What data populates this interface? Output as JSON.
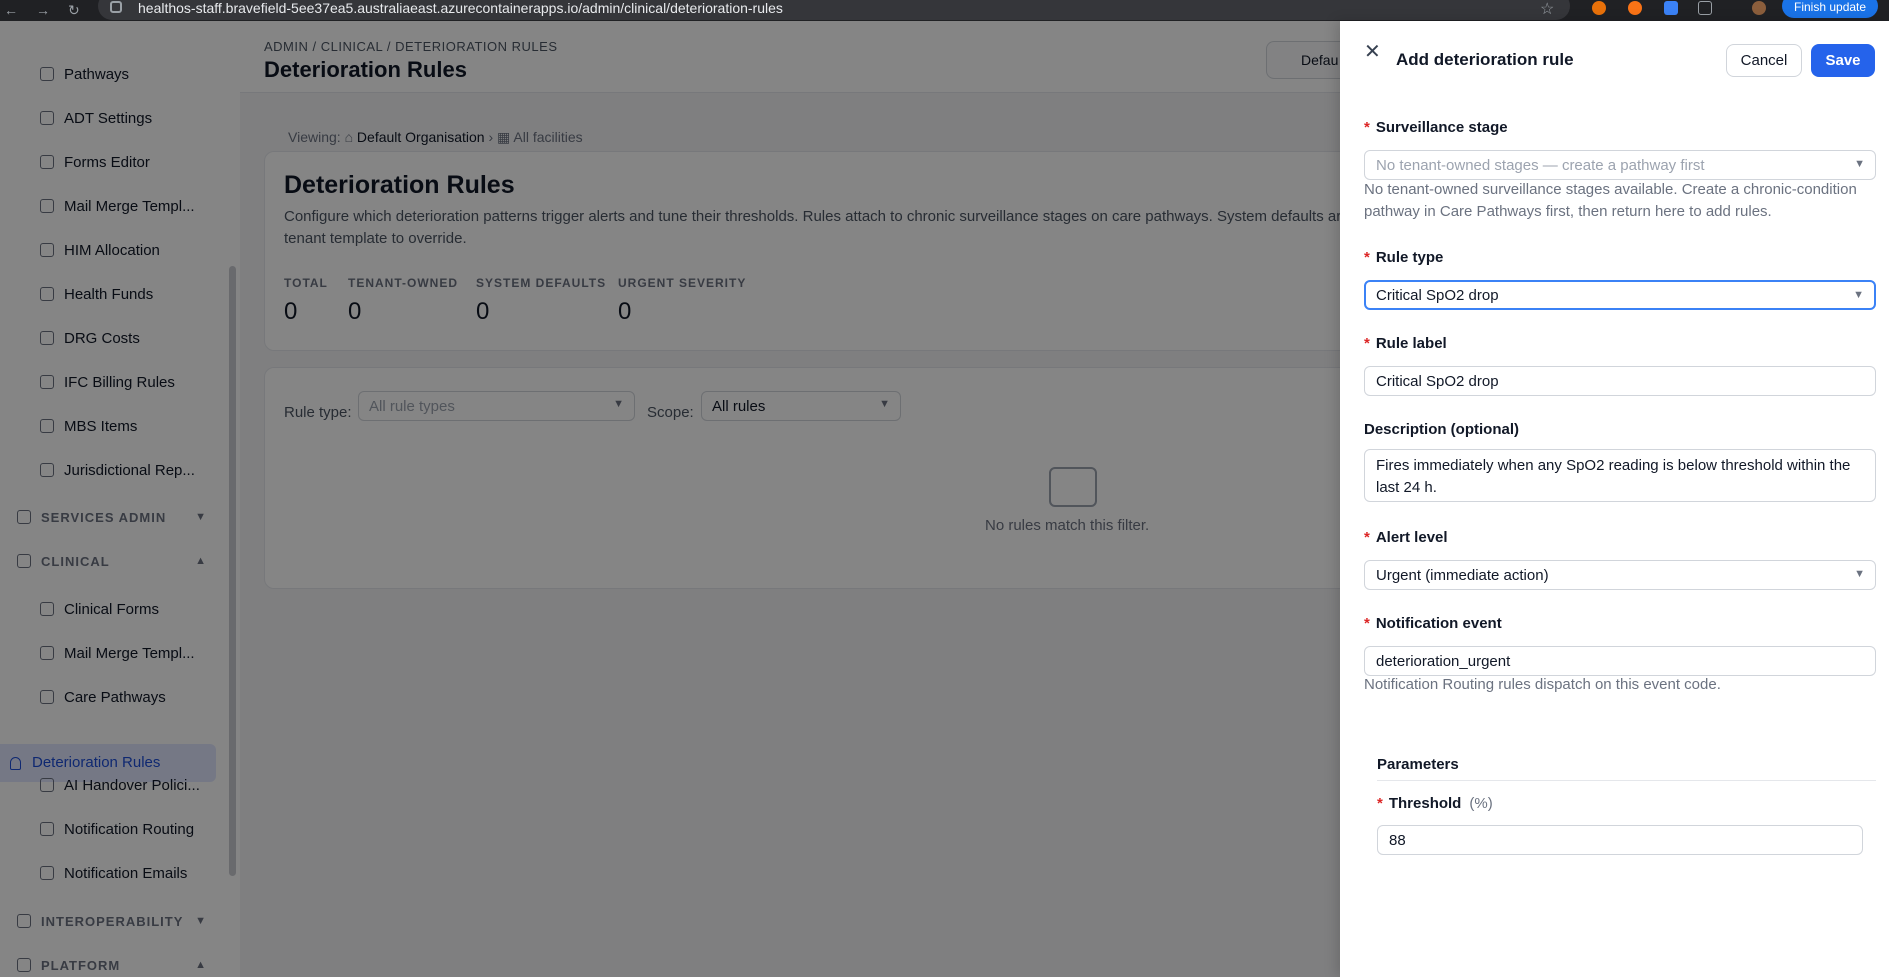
{
  "browser": {
    "url": "healthos-staff.bravefield-5ee37ea5.australiaeast.azurecontainerapps.io/admin/clinical/deterioration-rules",
    "update_label": "Finish update"
  },
  "sidebar": {
    "items_top": [
      {
        "label": "Pathways"
      },
      {
        "label": "ADT Settings"
      },
      {
        "label": "Forms Editor"
      },
      {
        "label": "Mail Merge Templ..."
      },
      {
        "label": "HIM Allocation"
      },
      {
        "label": "Health Funds"
      },
      {
        "label": "DRG Costs"
      },
      {
        "label": "IFC Billing Rules"
      },
      {
        "label": "MBS Items"
      },
      {
        "label": "Jurisdictional Rep..."
      }
    ],
    "sections": {
      "services": "SERVICES ADMIN",
      "clinical": "CLINICAL",
      "interop": "INTEROPERABILITY",
      "platform": "PLATFORM"
    },
    "items_clinical": [
      {
        "label": "Clinical Forms"
      },
      {
        "label": "Mail Merge Templ..."
      },
      {
        "label": "Care Pathways"
      }
    ],
    "active": "Deterioration Rules",
    "items_after": [
      {
        "label": "AI Handover Polici..."
      },
      {
        "label": "Notification Routing"
      },
      {
        "label": "Notification Emails"
      }
    ]
  },
  "header": {
    "breadcrumb": "ADMIN / CLINICAL / DETERIORATION RULES",
    "title": "Deterioration Rules",
    "org_btn": "Defau"
  },
  "viewing": {
    "label": "Viewing:",
    "org": "Default Organisation",
    "facilities": "All facilities"
  },
  "page": {
    "heading": "Deterioration Rules",
    "description": "Configure which deterioration patterns trigger alerts and tune their thresholds. Rules attach to chronic surveillance stages on care pathways. System defaults ar tenant template to override."
  },
  "stats": [
    {
      "key": "TOTAL",
      "value": "0"
    },
    {
      "key": "TENANT-OWNED",
      "value": "0"
    },
    {
      "key": "SYSTEM DEFAULTS",
      "value": "0"
    },
    {
      "key": "URGENT SEVERITY",
      "value": "0"
    }
  ],
  "filters": {
    "rule_type_label": "Rule type:",
    "rule_type_placeholder": "All rule types",
    "scope_label": "Scope:",
    "scope_value": "All rules",
    "empty": "No rules match this filter."
  },
  "drawer": {
    "title": "Add deterioration rule",
    "cancel": "Cancel",
    "save": "Save",
    "stage_label": "Surveillance stage",
    "stage_placeholder": "No tenant-owned stages — create a pathway first",
    "stage_help": "No tenant-owned surveillance stages available. Create a chronic-condition pathway in Care Pathways first, then return here to add rules.",
    "rule_type_label": "Rule type",
    "rule_type_value": "Critical SpO2 drop",
    "rule_label_label": "Rule label",
    "rule_label_value": "Critical SpO2 drop",
    "desc_label": "Description (optional)",
    "desc_value": "Fires immediately when any SpO2 reading is below threshold within the last 24 h.",
    "alert_label": "Alert level",
    "alert_value": "Urgent (immediate action)",
    "event_label": "Notification event",
    "event_value": "deterioration_urgent",
    "event_help": "Notification Routing rules dispatch on this event code.",
    "params_label": "Parameters",
    "threshold_label": "Threshold",
    "threshold_unit": "(%)",
    "threshold_value": "88"
  }
}
